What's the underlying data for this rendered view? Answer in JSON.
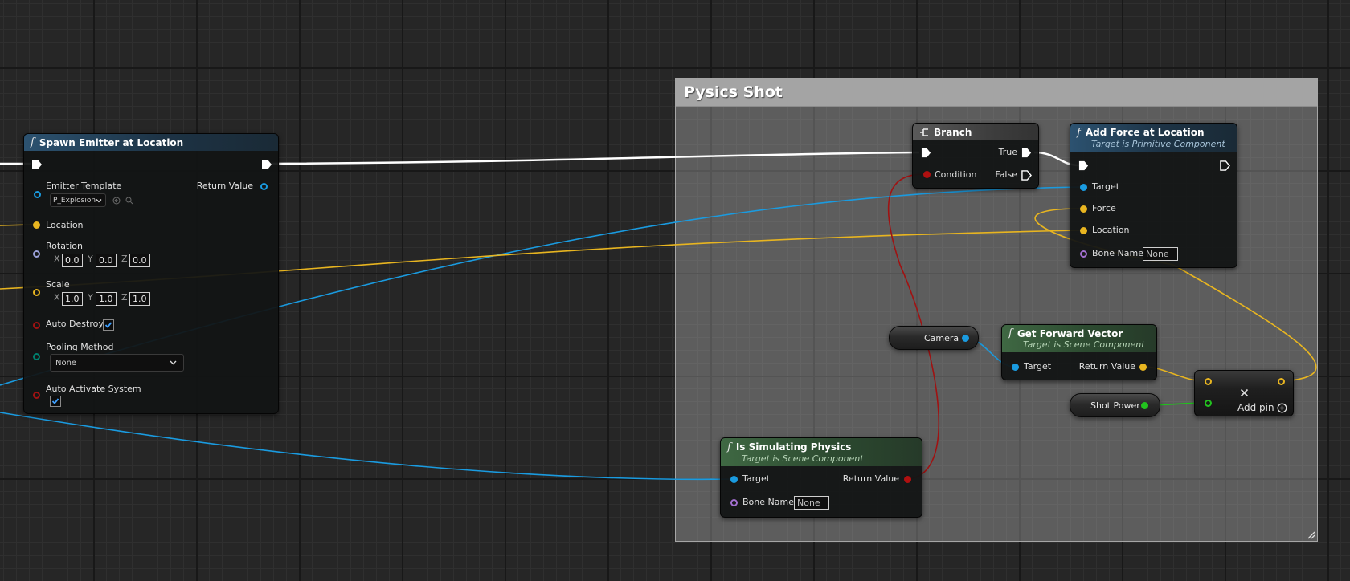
{
  "comment_box": {
    "title": "Pysics Shot"
  },
  "spawn_emitter": {
    "title": "Spawn Emitter at Location",
    "pins": {
      "emitter_template": "Emitter Template",
      "emitter_value": "P_Explosion",
      "return_value": "Return Value",
      "location": "Location",
      "rotation": "Rotation",
      "rot_x": "0.0",
      "rot_y": "0.0",
      "rot_z": "0.0",
      "scale": "Scale",
      "scale_x": "1.0",
      "scale_y": "1.0",
      "scale_z": "1.0",
      "auto_destroy": "Auto Destroy",
      "pooling_method": "Pooling Method",
      "pooling_value": "None",
      "auto_activate": "Auto Activate System"
    },
    "axis_labels": {
      "x": "X",
      "y": "Y",
      "z": "Z"
    }
  },
  "branch": {
    "title": "Branch",
    "pins": {
      "true_label": "True",
      "condition": "Condition",
      "false_label": "False"
    }
  },
  "add_force": {
    "title": "Add Force at Location",
    "subtitle": "Target is Primitive Component",
    "pins": {
      "target": "Target",
      "force": "Force",
      "location": "Location",
      "bone_name": "Bone Name",
      "bone_value": "None"
    }
  },
  "camera": {
    "label": "Camera"
  },
  "get_forward": {
    "title": "Get Forward Vector",
    "subtitle": "Target is Scene Component",
    "pins": {
      "target": "Target",
      "return_value": "Return Value"
    }
  },
  "shot_power": {
    "label": "Shot Power"
  },
  "multiply": {
    "add_pin": "Add pin"
  },
  "is_simulating": {
    "title": "Is Simulating Physics",
    "subtitle": "Target is Scene Component",
    "pins": {
      "target": "Target",
      "return_value": "Return Value",
      "bone_name": "Bone Name",
      "bone_value": "None"
    }
  },
  "colors": {
    "exec_wire": "#ffffff",
    "object_wire": "#1a9be0",
    "vector_wire": "#e8b520",
    "bool_wire": "#a01212",
    "float_wire": "#22c21e"
  },
  "auto_destroy_checked": true,
  "auto_activate_checked": true
}
